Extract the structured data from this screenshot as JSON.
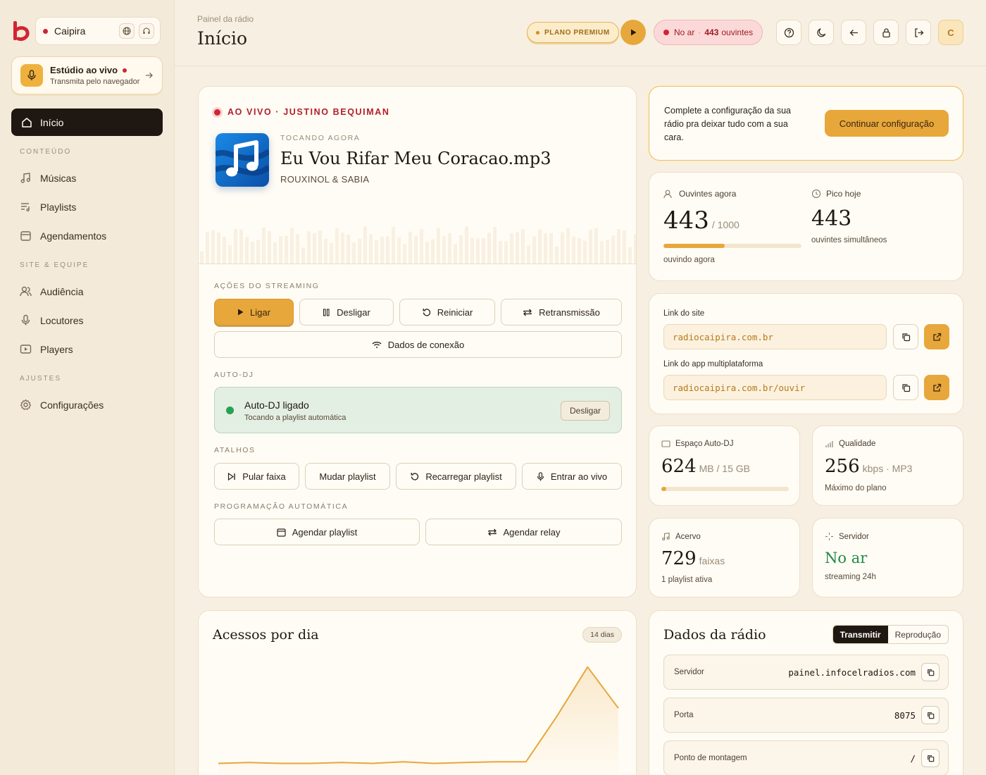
{
  "sidebar": {
    "station": "Caipira",
    "studio": {
      "title": "Estúdio ao vivo",
      "subtitle": "Transmita pelo navegador"
    },
    "active_item": "Início",
    "sections": [
      {
        "label": "CONTEÚDO",
        "items": [
          "Músicas",
          "Playlists",
          "Agendamentos"
        ]
      },
      {
        "label": "SITE & EQUIPE",
        "items": [
          "Audiência",
          "Locutores",
          "Players"
        ]
      },
      {
        "label": "AJUSTES",
        "items": [
          "Configurações"
        ]
      }
    ]
  },
  "header": {
    "breadcrumb": "Painel da rádio",
    "title": "Início",
    "plan": "PLANO PREMIUM",
    "onair_label": "No ar",
    "listeners_count": "443",
    "listeners_word": "ouvintes",
    "avatar": "C"
  },
  "now_playing": {
    "live_label": "AO VIVO · JUSTINO BEQUIMAN",
    "label": "TOCANDO AGORA",
    "title": "Eu Vou Rifar Meu Coracao.mp3",
    "artist": "ROUXINOL & SABIA"
  },
  "streaming": {
    "label": "AÇÕES DO STREAMING",
    "on": "Ligar",
    "off": "Desligar",
    "restart": "Reiniciar",
    "relay": "Retransmissão",
    "connection": "Dados de conexão"
  },
  "autodj": {
    "label": "AUTO-DJ",
    "title": "Auto-DJ ligado",
    "subtitle": "Tocando a playlist automática",
    "off_button": "Desligar"
  },
  "shortcuts": {
    "label": "ATALHOS",
    "skip": "Pular faixa",
    "change_playlist": "Mudar playlist",
    "reload_playlist": "Recarregar playlist",
    "go_live": "Entrar ao vivo"
  },
  "schedule": {
    "label": "PROGRAMAÇÃO AUTOMÁTICA",
    "playlist": "Agendar playlist",
    "relay": "Agendar relay"
  },
  "setup": {
    "text": "Complete a configuração da sua rádio pra deixar tudo com a sua cara.",
    "cta": "Continuar configuração"
  },
  "listeners": {
    "label": "Ouvintes agora",
    "value": "443",
    "max": "/ 1000",
    "fraction": 0.443,
    "sub": "ouvindo agora",
    "peak_label": "Pico hoje",
    "peak_value": "443",
    "peak_sub": "ouvintes simultâneos"
  },
  "links": {
    "site_label": "Link do site",
    "site_url": "radiocaipira.com.br",
    "app_label": "Link do app multiplataforma",
    "app_url": "radiocaipira.com.br/ouvir"
  },
  "storage": {
    "label": "Espaço Auto-DJ",
    "value": "624",
    "unit": "MB / 15 GB",
    "fraction": 0.04
  },
  "quality": {
    "label": "Qualidade",
    "value": "256",
    "unit": "kbps · MP3",
    "sub": "Máximo do plano"
  },
  "library": {
    "label": "Acervo",
    "value": "729",
    "unit": "faixas",
    "sub": "1 playlist ativa"
  },
  "server": {
    "label": "Servidor",
    "value": "No ar",
    "sub": "streaming 24h"
  },
  "accesses": {
    "title": "Acessos por dia",
    "badge": "14 dias"
  },
  "radio_data": {
    "title": "Dados da rádio",
    "tab_active": "Transmitir",
    "tab_other": "Reprodução",
    "rows": [
      {
        "key": "Servidor",
        "value": "painel.infocelradios.com"
      },
      {
        "key": "Porta",
        "value": "8075"
      },
      {
        "key": "Ponto de montagem",
        "value": "/"
      }
    ]
  },
  "chart_data": {
    "type": "area",
    "title": "Acessos por dia",
    "x": [
      1,
      2,
      3,
      4,
      5,
      6,
      7,
      8,
      9,
      10,
      11,
      12,
      13,
      14
    ],
    "values": [
      3,
      4,
      3,
      3,
      4,
      3,
      5,
      3,
      4,
      5,
      5,
      60,
      120,
      70
    ],
    "ylim": [
      0,
      130
    ],
    "color": "#e7a73b"
  },
  "colors": {
    "accent": "#e7a73b",
    "live": "#d12432",
    "success": "#28a055",
    "dark": "#1f1711"
  }
}
